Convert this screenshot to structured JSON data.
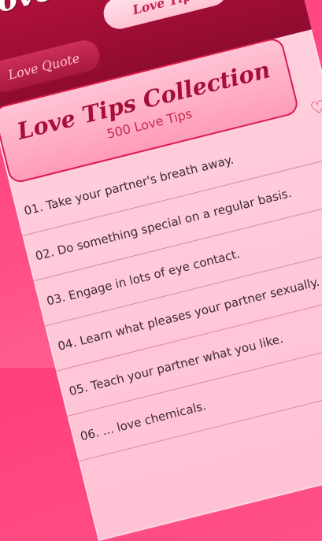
{
  "header": {
    "title": "Love Tips",
    "tabs": [
      {
        "label": "Love Quote"
      },
      {
        "label": "Love Tips"
      }
    ]
  },
  "card": {
    "title": "Love Tips Collection",
    "subtitle": "500 Love Tips"
  },
  "tips": [
    {
      "text": "01. Take your partner's breath away."
    },
    {
      "text": "02. Do something special on a regular basis."
    },
    {
      "text": "03. Engage in lots of eye contact."
    },
    {
      "text": "04. Learn what pleases your partner sexually."
    },
    {
      "text": "05. Teach your partner what you like."
    },
    {
      "text": "06. ... love chemicals."
    }
  ],
  "icons": {
    "favorite": "heart-outline-icon"
  },
  "colors": {
    "accent": "#e0204e",
    "header": "#b8123f",
    "background": "#ff4f86"
  }
}
